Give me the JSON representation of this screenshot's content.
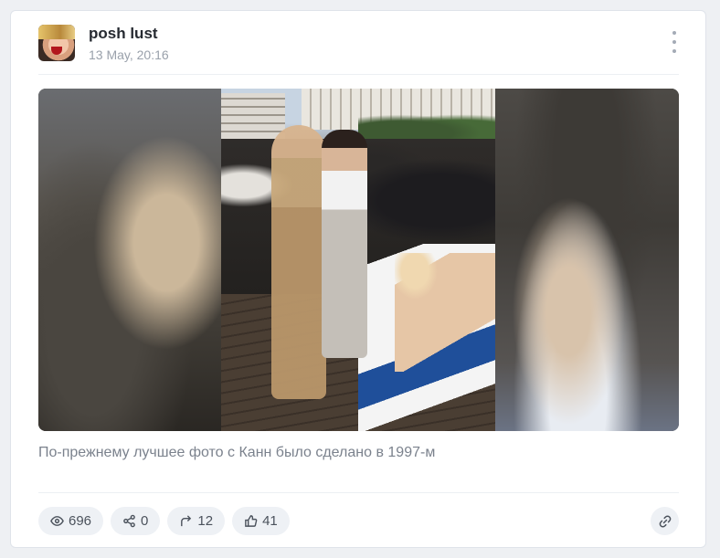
{
  "post": {
    "author": "posh lust",
    "date": "13 May, 20:16",
    "caption": "По-прежнему лучшее фото с Канн было сделано в 1997-м"
  },
  "icons": {
    "menu": "more-vertical-icon",
    "views": "eye-icon",
    "shares": "share-icon",
    "forwards": "forward-arrow-icon",
    "likes": "thumbs-up-icon",
    "link": "link-icon"
  },
  "stats": {
    "views": "696",
    "shares": "0",
    "forwards": "12",
    "likes": "41"
  },
  "colors": {
    "background": "#eef0f3",
    "card": "#ffffff",
    "pill": "#eef1f5",
    "muted_text": "#9aa1ab"
  }
}
